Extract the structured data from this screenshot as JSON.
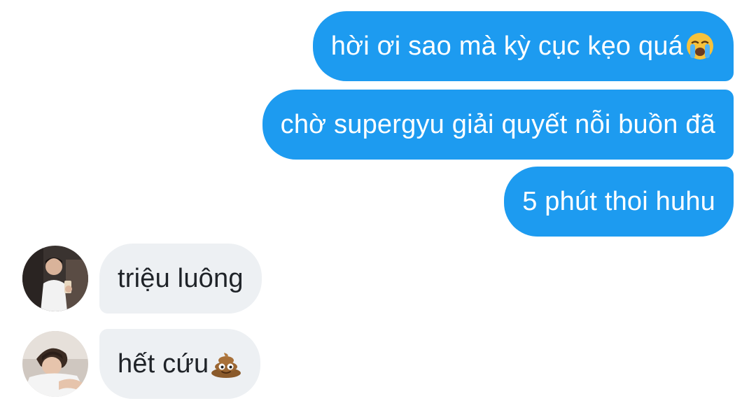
{
  "conversation": {
    "outgoing": [
      {
        "text": "hời ơi sao mà kỳ cục kẹo quá",
        "emoji": "loudly-crying-face-icon"
      },
      {
        "text": "chờ supergyu giải quyết nỗi buồn đã"
      },
      {
        "text": "5 phút thoi huhu"
      }
    ],
    "incoming": [
      {
        "text": "triệu luông"
      },
      {
        "text": "hết cứu",
        "emoji": "pile-of-poo-icon"
      }
    ]
  },
  "colors": {
    "outgoing_bubble": "#1d9bf0",
    "incoming_bubble": "#edf0f3",
    "background": "#ffffff"
  }
}
